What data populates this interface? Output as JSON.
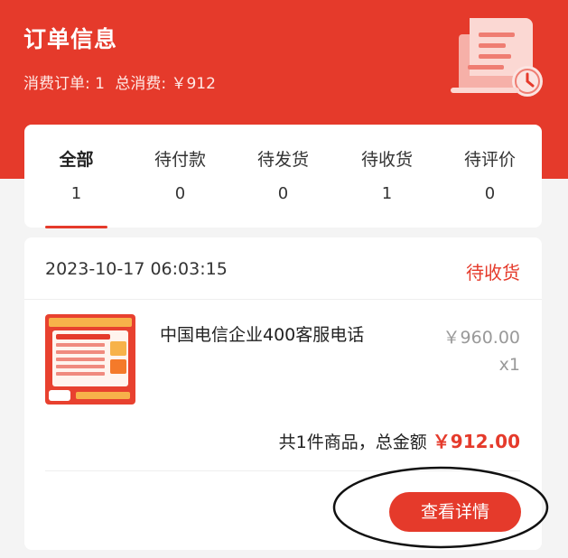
{
  "header": {
    "title": "订单信息",
    "order_count_label": "消费订单: 1",
    "total_spend_label": "总消费: ￥912"
  },
  "tabs": [
    {
      "label": "全部",
      "count": "1"
    },
    {
      "label": "待付款",
      "count": "0"
    },
    {
      "label": "待发货",
      "count": "0"
    },
    {
      "label": "待收货",
      "count": "1"
    },
    {
      "label": "待评价",
      "count": "0"
    }
  ],
  "order": {
    "date": "2023-10-17 06:03:15",
    "status": "待收货",
    "product": {
      "name": "中国电信企业400客服电话",
      "price": "￥960.00",
      "quantity": "x1"
    },
    "summary_label": "共1件商品，总金额",
    "total_amount": "￥912.00",
    "detail_button_label": "查看详情"
  },
  "colors": {
    "brand": "#e53a2b",
    "page_bg": "#f4f4f4"
  }
}
